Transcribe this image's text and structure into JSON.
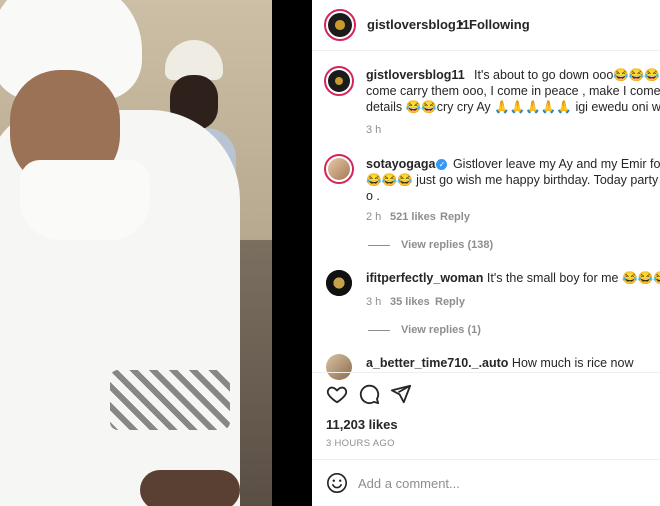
{
  "header": {
    "username": "gistloversblog11",
    "separator": "•",
    "follow_label": "Following"
  },
  "comments": [
    {
      "username": "gistloversblog11",
      "lines": [
        "It's about to go down ooo😂😂😂😂 Sota",
        "come carry them ooo, I come in peace , make I come writ",
        "details 😂😂cry cry Ay 🙏🙏🙏🙏🙏 igi ewedu oni wo luwa o"
      ],
      "time": "3 h"
    },
    {
      "username": "sotayogaga",
      "verified": true,
      "lines": [
        "Gistlover leave my Ay and my Emir for me",
        "😂😂😂 just go wish me happy birthday. Today party go lo",
        "o ."
      ],
      "time": "2 h",
      "likes": "521 likes",
      "reply_label": "Reply",
      "view_replies": "View replies (138)"
    },
    {
      "username": "ifitperfectly_woman",
      "lines": [
        "It's the small boy for me 😂😂😂😂"
      ],
      "time": "3 h",
      "likes": "35 likes",
      "reply_label": "Reply",
      "view_replies": "View replies (1)"
    },
    {
      "username": "a_better_time710._.auto",
      "lines": [
        "How much is rice now"
      ]
    }
  ],
  "actions": {
    "like_icon": "heart-icon",
    "comment_icon": "comment-icon",
    "share_icon": "share-icon"
  },
  "likes_count": "11,203 likes",
  "posted_ago": "3 HOURS AGO",
  "add_comment": {
    "placeholder": "Add a comment..."
  },
  "colors": {
    "story_ring": "#d5245a",
    "verified": "#3897f0",
    "text": "#262626",
    "muted": "#8e8e8e"
  }
}
